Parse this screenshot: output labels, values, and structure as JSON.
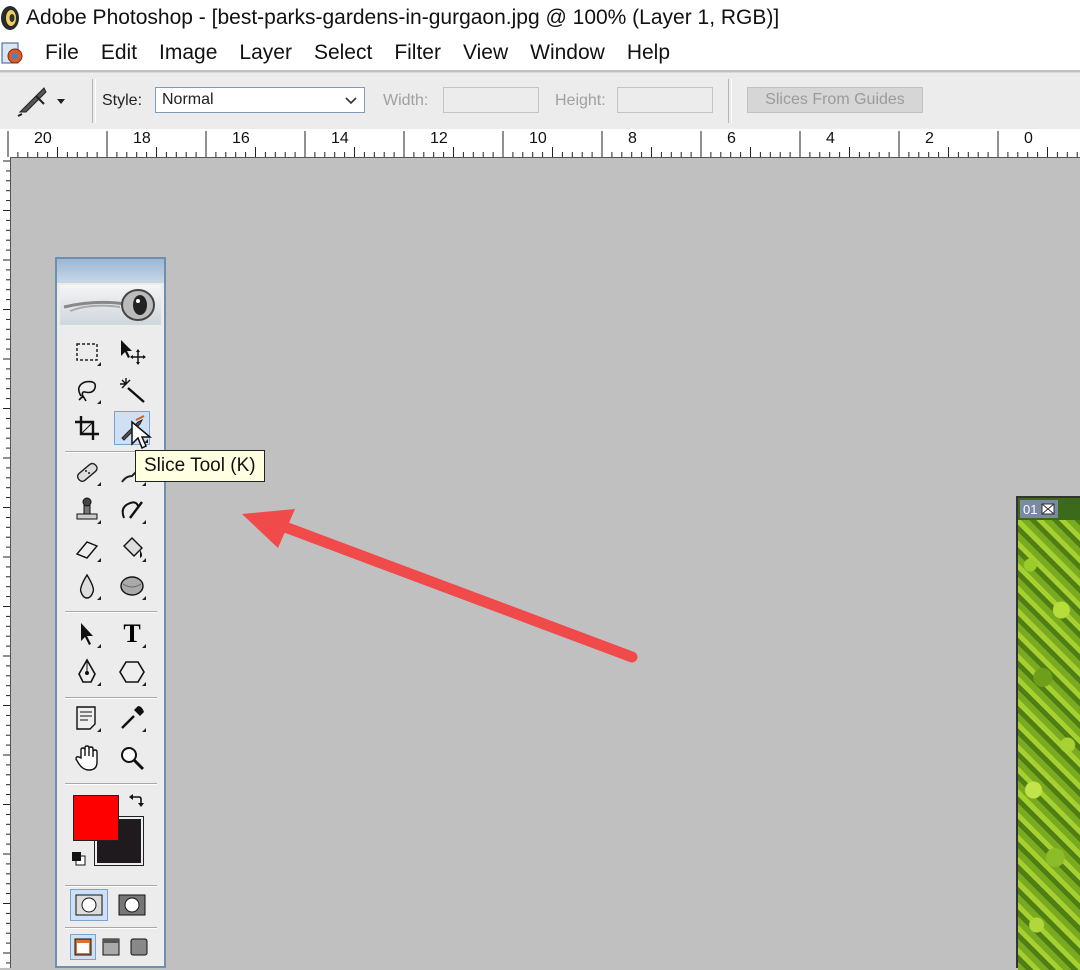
{
  "window": {
    "title": "Adobe Photoshop - [best-parks-gardens-in-gurgaon.jpg @ 100% (Layer 1, RGB)]"
  },
  "menu": {
    "items": [
      "File",
      "Edit",
      "Image",
      "Layer",
      "Select",
      "Filter",
      "View",
      "Window",
      "Help"
    ]
  },
  "options_bar": {
    "active_tool_icon": "slice-tool-icon",
    "style_label": "Style:",
    "style_value": "Normal",
    "width_label": "Width:",
    "width_value": "",
    "height_label": "Height:",
    "height_value": "",
    "slices_button_label": "Slices From Guides"
  },
  "ruler": {
    "labels": [
      "20",
      "18",
      "16",
      "14",
      "12",
      "10",
      "8",
      "6",
      "4",
      "2",
      "0"
    ]
  },
  "toolbox": {
    "tools": [
      "rectangular-marquee-tool-icon",
      "move-tool-icon",
      "lasso-tool-icon",
      "magic-wand-tool-icon",
      "crop-tool-icon",
      "slice-tool-icon",
      "healing-brush-tool-icon",
      "brush-tool-icon",
      "clone-stamp-tool-icon",
      "history-brush-tool-icon",
      "eraser-tool-icon",
      "paint-bucket-tool-icon",
      "blur-tool-icon",
      "dodge-tool-icon",
      "path-selection-tool-icon",
      "type-tool-icon",
      "pen-tool-icon",
      "shape-tool-icon",
      "notes-tool-icon",
      "eyedropper-tool-icon",
      "hand-tool-icon",
      "zoom-tool-icon"
    ],
    "type_tool_glyph": "T",
    "foreground_color": "#ff0000",
    "background_color": "#1e1a1e"
  },
  "tooltip": {
    "text": "Slice Tool (K)"
  },
  "document": {
    "slice_number": "01"
  },
  "annotation": {
    "arrow_color": "#f04a4a"
  }
}
